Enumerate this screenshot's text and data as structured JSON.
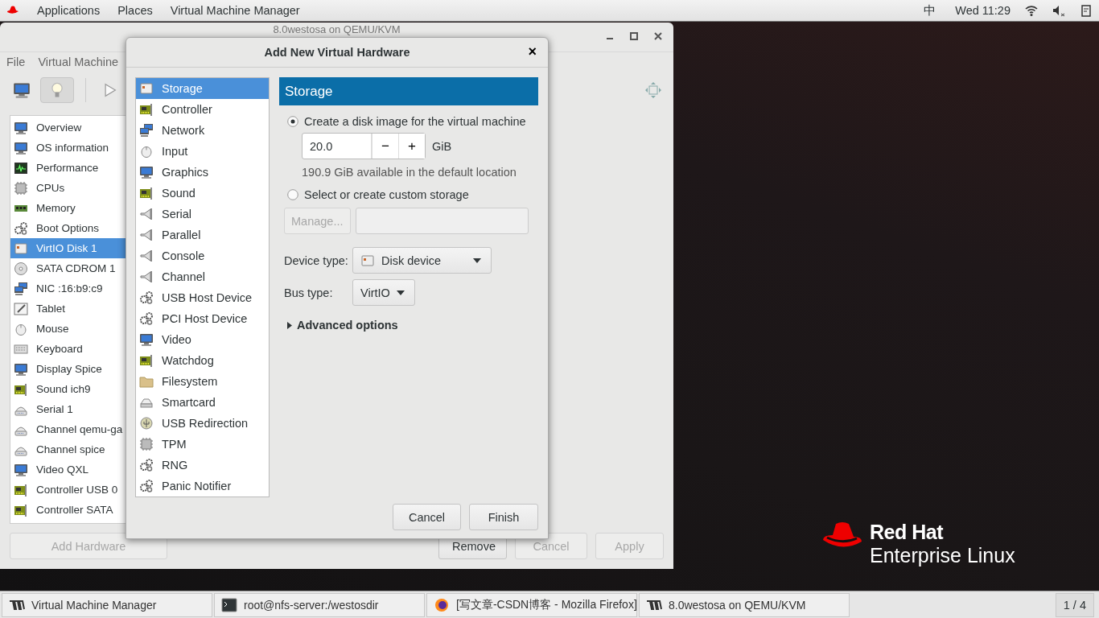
{
  "top_bar": {
    "menus": [
      "Applications",
      "Places",
      "Virtual Machine Manager"
    ],
    "input_method": "中",
    "clock": "Wed 11:29"
  },
  "vm_window": {
    "title": "8.0westosa on QEMU/KVM",
    "menus": [
      "File",
      "Virtual Machine"
    ],
    "toolbar": [
      {
        "kind": "monitor",
        "selected": false
      },
      {
        "kind": "bulb",
        "selected": true
      },
      {
        "kind": "play",
        "selected": false
      }
    ],
    "hardware_list": [
      {
        "label": "Overview",
        "kind": "monitor",
        "selected": false
      },
      {
        "label": "OS information",
        "kind": "monitor",
        "selected": false
      },
      {
        "label": "Performance",
        "kind": "chart",
        "selected": false
      },
      {
        "label": "CPUs",
        "kind": "chip",
        "selected": false
      },
      {
        "label": "Memory",
        "kind": "memory",
        "selected": false
      },
      {
        "label": "Boot Options",
        "kind": "gears",
        "selected": false
      },
      {
        "label": "VirtIO Disk 1",
        "kind": "disk",
        "selected": true
      },
      {
        "label": "SATA CDROM 1",
        "kind": "disc",
        "selected": false
      },
      {
        "label": "NIC :16:b9:c9",
        "kind": "network",
        "selected": false
      },
      {
        "label": "Tablet",
        "kind": "tablet",
        "selected": false
      },
      {
        "label": "Mouse",
        "kind": "mouse",
        "selected": false
      },
      {
        "label": "Keyboard",
        "kind": "keyboard",
        "selected": false
      },
      {
        "label": "Display Spice",
        "kind": "monitor",
        "selected": false
      },
      {
        "label": "Sound ich9",
        "kind": "card",
        "selected": false
      },
      {
        "label": "Serial 1",
        "kind": "plug",
        "selected": false
      },
      {
        "label": "Channel qemu-ga",
        "kind": "plug",
        "selected": false
      },
      {
        "label": "Channel spice",
        "kind": "plug",
        "selected": false
      },
      {
        "label": "Video QXL",
        "kind": "monitor",
        "selected": false
      },
      {
        "label": "Controller USB 0",
        "kind": "card",
        "selected": false
      },
      {
        "label": "Controller SATA",
        "kind": "card",
        "selected": false
      }
    ],
    "buttons": [
      {
        "label": "Add Hardware",
        "disabled": true
      },
      {
        "label": "Remove",
        "disabled": false
      },
      {
        "label": "Cancel",
        "disabled": true
      },
      {
        "label": "Apply",
        "disabled": true
      }
    ]
  },
  "dialog": {
    "title": "Add New Virtual Hardware",
    "close": "×",
    "categories": [
      {
        "label": "Storage",
        "kind": "disk",
        "selected": true
      },
      {
        "label": "Controller",
        "kind": "card",
        "selected": false
      },
      {
        "label": "Network",
        "kind": "network",
        "selected": false
      },
      {
        "label": "Input",
        "kind": "mouse",
        "selected": false
      },
      {
        "label": "Graphics",
        "kind": "monitor",
        "selected": false
      },
      {
        "label": "Sound",
        "kind": "card",
        "selected": false
      },
      {
        "label": "Serial",
        "kind": "connector",
        "selected": false
      },
      {
        "label": "Parallel",
        "kind": "connector",
        "selected": false
      },
      {
        "label": "Console",
        "kind": "connector",
        "selected": false
      },
      {
        "label": "Channel",
        "kind": "connector",
        "selected": false
      },
      {
        "label": "USB Host Device",
        "kind": "gears",
        "selected": false
      },
      {
        "label": "PCI Host Device",
        "kind": "gears",
        "selected": false
      },
      {
        "label": "Video",
        "kind": "monitor",
        "selected": false
      },
      {
        "label": "Watchdog",
        "kind": "card",
        "selected": false
      },
      {
        "label": "Filesystem",
        "kind": "folder",
        "selected": false
      },
      {
        "label": "Smartcard",
        "kind": "reader",
        "selected": false
      },
      {
        "label": "USB Redirection",
        "kind": "usb",
        "selected": false
      },
      {
        "label": "TPM",
        "kind": "chip",
        "selected": false
      },
      {
        "label": "RNG",
        "kind": "gears",
        "selected": false
      },
      {
        "label": "Panic Notifier",
        "kind": "gears",
        "selected": false
      }
    ],
    "panel_title": "Storage",
    "options": [
      {
        "label": "Create a disk image for the virtual machine",
        "selected": true
      },
      {
        "label": "Select or create custom storage",
        "selected": false
      }
    ],
    "size": "20.0",
    "decrement": "−",
    "increment": "+",
    "unit": "GiB",
    "available": "190.9 GiB available in the default location",
    "manage_button": {
      "label": "Manage...",
      "disabled": true
    },
    "device_type": {
      "label": "Device type:",
      "value": "Disk device"
    },
    "bus_type": {
      "label": "Bus type:",
      "value": "VirtIO"
    },
    "advanced": {
      "label": "Advanced options",
      "expanded": false
    },
    "buttons": [
      "Cancel",
      "Finish"
    ]
  },
  "branding": {
    "line1": "Red Hat",
    "line2": "Enterprise Linux"
  },
  "taskbar": {
    "items": [
      {
        "label": "Virtual Machine Manager",
        "kind": "vmm"
      },
      {
        "label": "root@nfs-server:/westosdir",
        "kind": "terminal"
      },
      {
        "label": "[写文章-CSDN博客 - Mozilla Firefox]",
        "kind": "browser"
      },
      {
        "label": "8.0westosa on QEMU/KVM",
        "kind": "vmm"
      }
    ],
    "workspace": "1 / 4"
  }
}
